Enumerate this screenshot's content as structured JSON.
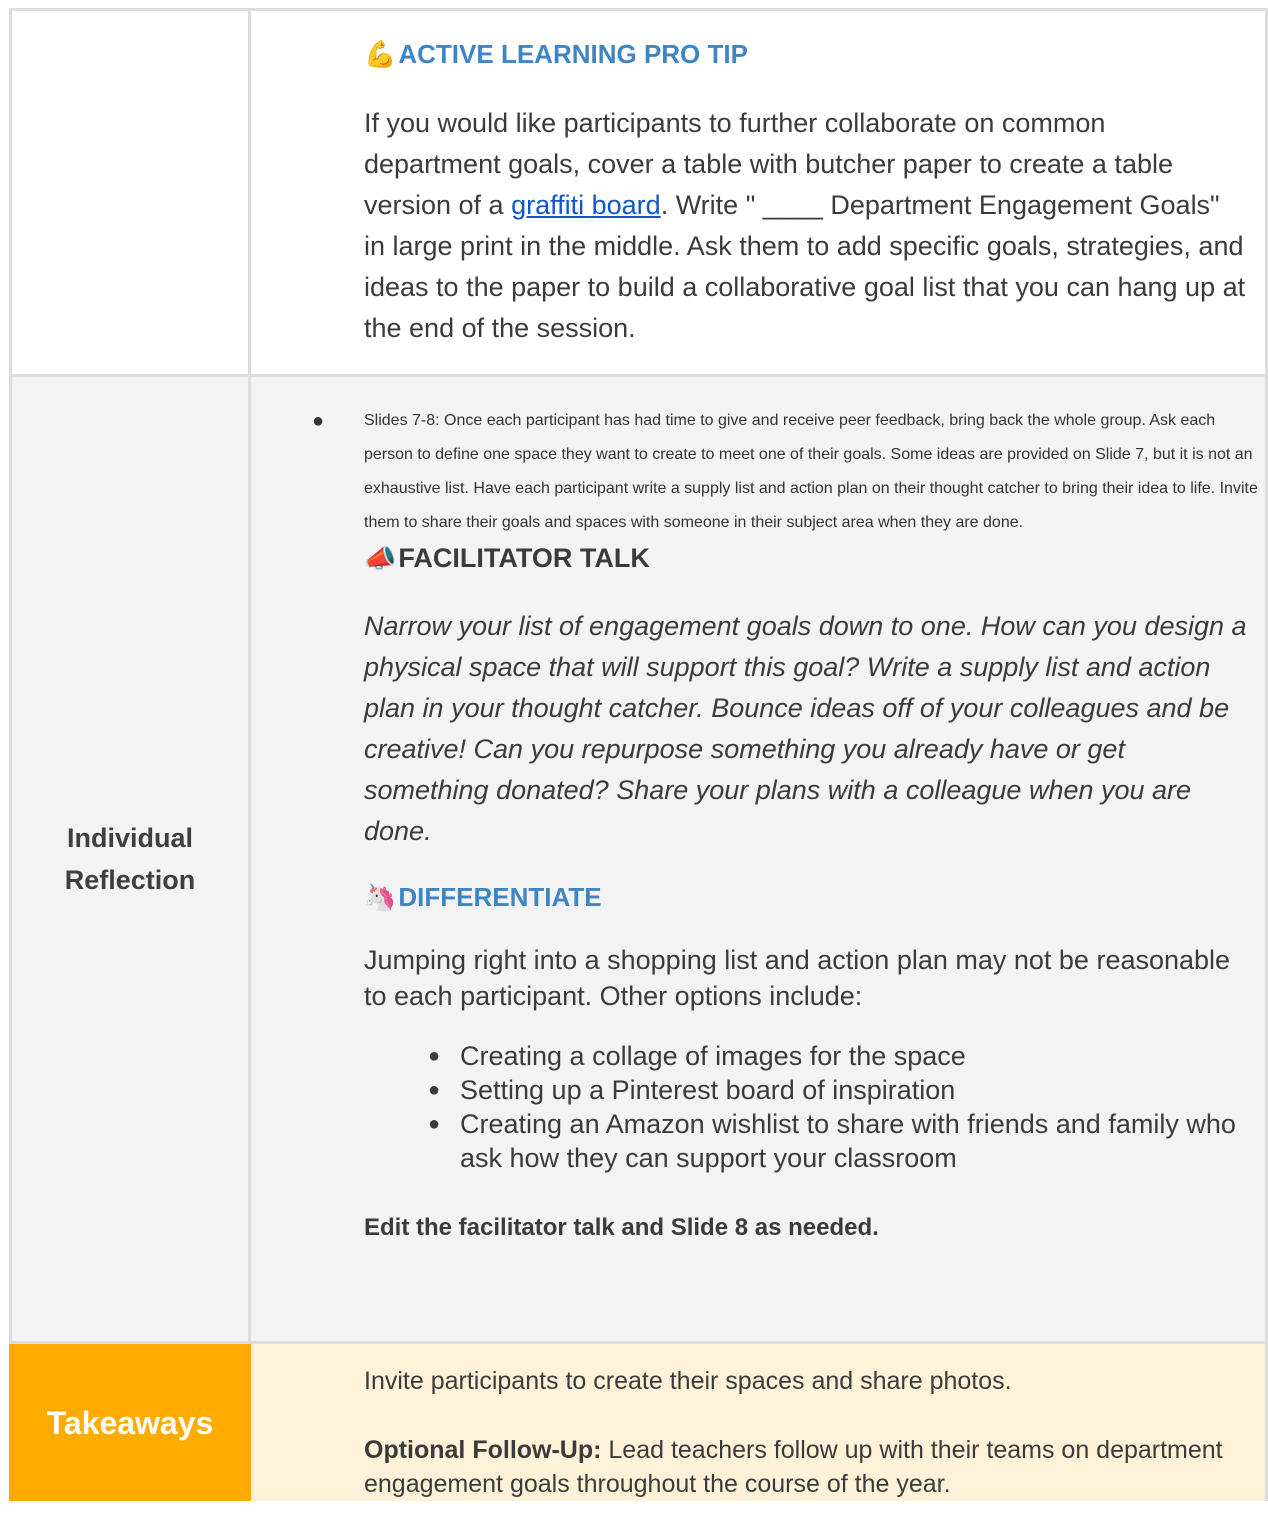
{
  "row_top": {
    "label": "",
    "pro_tip": {
      "emoji": "💪",
      "icon": "flexed-biceps-icon",
      "heading": "ACTIVE LEARNING PRO TIP",
      "text_before_link": "If you would like participants to further collaborate on common department goals, cover a table with butcher paper to create a table version of a ",
      "link_text": "graffiti board",
      "text_after_link": ". Write \" ____ Department Engagement Goals\" in large print in the middle. Ask them to add specific goals, strategies, and ideas to the paper to build a collaborative goal list that you can hang up at the end of the session."
    }
  },
  "row_mid": {
    "label_line1": "Individual",
    "label_line2": "Reflection",
    "bullet_text": "Slides 7-8: Once each participant has had time to give and receive peer feedback, bring back the whole group. Ask each person to define one space they want to create to meet one of their goals. Some ideas are provided on Slide 7, but it is not an exhaustive list. Have each participant write a supply list and action plan on their thought catcher to bring their idea to life. Invite them to share their goals and spaces with someone in their subject area when they are done.",
    "facilitator": {
      "emoji": "📣",
      "icon": "megaphone-icon",
      "heading": "FACILITATOR TALK",
      "text": "Narrow your list of engagement goals down to one. How can you design a physical space that will support this goal? Write a supply list and action plan in your thought catcher. Bounce ideas off of your colleagues and be creative! Can you repurpose something you already have or get something donated? Share your plans with a colleague when you are done."
    },
    "differentiate": {
      "emoji": "🦄",
      "icon": "unicorn-icon",
      "heading": "DIFFERENTIATE",
      "intro": "Jumping right into a shopping list and action plan may not be reasonable to each participant. Other options include:",
      "options": [
        "Creating a collage of images for the space",
        "Setting up a Pinterest board of inspiration",
        "Creating an Amazon wishlist to share with friends and family who ask how they can support your classroom"
      ],
      "closing": "Edit the facilitator talk and Slide 8 as needed."
    }
  },
  "row_bottom": {
    "label": "Takeaways",
    "line1": "Invite participants to create their spaces and share photos.",
    "followup_label": "Optional Follow-Up:",
    "followup_text": " Lead teachers follow up with their teams on department engagement goals throughout the course of the year."
  },
  "colors": {
    "accent_blue": "#3d85c6",
    "link_blue": "#1155cc",
    "takeaway_orange": "#ffab00",
    "takeaway_bg": "#fff2d9"
  }
}
